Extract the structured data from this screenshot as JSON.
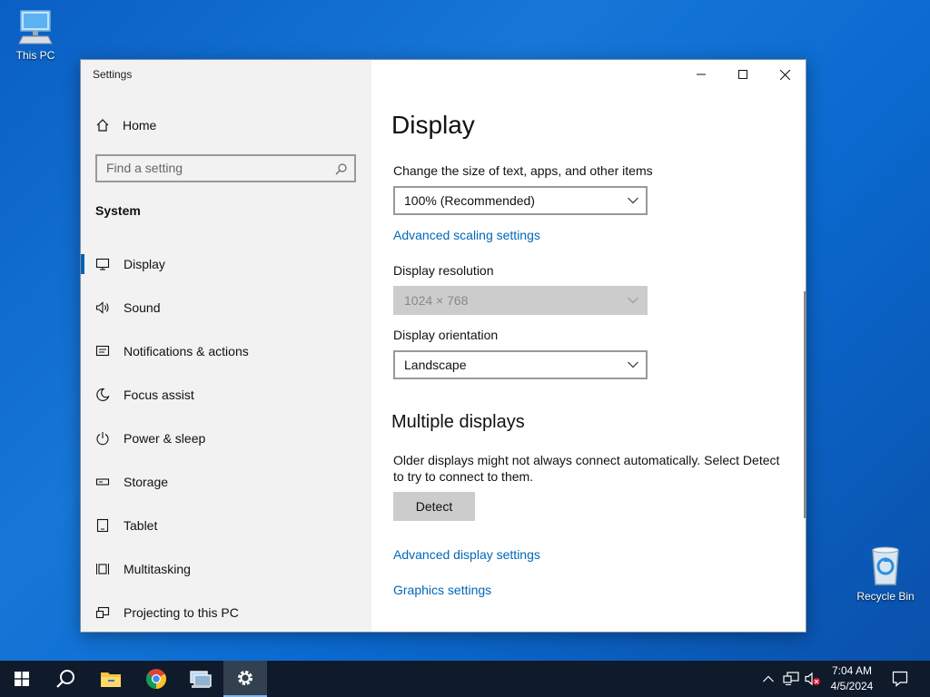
{
  "desktop": {
    "icons": [
      {
        "label": "This PC"
      },
      {
        "label": "Recycle Bin"
      }
    ]
  },
  "window": {
    "title": "Settings",
    "controls": {
      "minimize": "minimize-icon",
      "maximize": "maximize-icon",
      "close": "close-icon"
    }
  },
  "sidebar": {
    "home_label": "Home",
    "search": {
      "placeholder": "Find a setting"
    },
    "section_label": "System",
    "items": [
      {
        "label": "Display",
        "icon": "monitor-icon",
        "selected": true
      },
      {
        "label": "Sound",
        "icon": "speaker-icon"
      },
      {
        "label": "Notifications & actions",
        "icon": "notification-icon"
      },
      {
        "label": "Focus assist",
        "icon": "moon-icon"
      },
      {
        "label": "Power & sleep",
        "icon": "power-icon"
      },
      {
        "label": "Storage",
        "icon": "storage-icon"
      },
      {
        "label": "Tablet",
        "icon": "tablet-icon"
      },
      {
        "label": "Multitasking",
        "icon": "multitasking-icon"
      },
      {
        "label": "Projecting to this PC",
        "icon": "projector-icon"
      }
    ]
  },
  "main": {
    "title": "Display",
    "scale": {
      "label": "Change the size of text, apps, and other items",
      "value": "100% (Recommended)"
    },
    "advanced_scaling_link": "Advanced scaling settings",
    "resolution": {
      "label": "Display resolution",
      "value": "1024 × 768",
      "disabled": true
    },
    "orientation": {
      "label": "Display orientation",
      "value": "Landscape"
    },
    "multiple_displays": {
      "heading": "Multiple displays",
      "description": "Older displays might not always connect automatically. Select Detect to try to connect to them.",
      "detect_button": "Detect"
    },
    "advanced_display_link": "Advanced display settings",
    "graphics_link": "Graphics settings"
  },
  "taskbar": {
    "items": [
      "start-icon",
      "search-icon",
      "file-explorer-icon",
      "chrome-icon",
      "network-app-icon",
      "settings-icon"
    ],
    "active": "settings-icon",
    "tray": [
      "chevron-up-icon",
      "network-icon",
      "volume-muted-icon"
    ],
    "time": "7:04 AM",
    "date": "4/5/2024",
    "colors": {
      "accent": "#0063b1",
      "link": "#0067b8",
      "taskbar": "#0f1a2b"
    }
  }
}
